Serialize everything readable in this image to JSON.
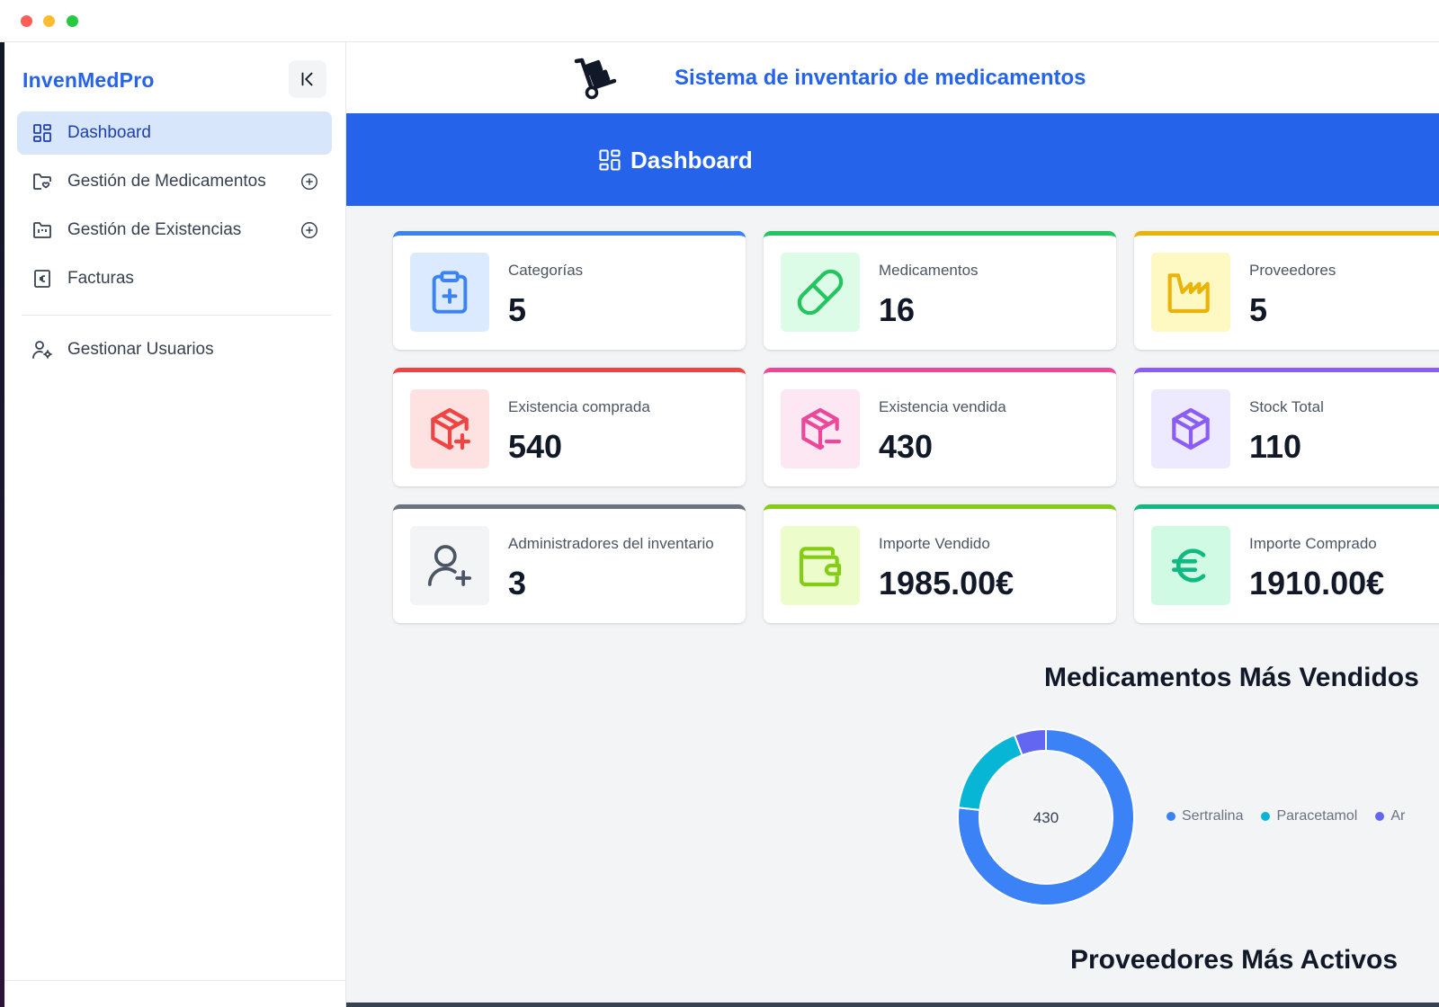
{
  "sidebar": {
    "brand": "InvenMedPro",
    "items": [
      {
        "label": "Dashboard",
        "active": true
      },
      {
        "label": "Gestión de Medicamentos",
        "expandable": true
      },
      {
        "label": "Gestión de Existencias",
        "expandable": true
      },
      {
        "label": "Facturas"
      },
      {
        "label": "Gestionar Usuarios"
      }
    ]
  },
  "header": {
    "title": "Sistema de inventario de medicamentos",
    "banner_title": "Dashboard"
  },
  "cards": [
    {
      "label": "Categorías",
      "value": "5",
      "accent": "#3b82f6",
      "icon": "clipboard-plus-icon"
    },
    {
      "label": "Medicamentos",
      "value": "16",
      "accent": "#22c55e",
      "icon": "pill-icon"
    },
    {
      "label": "Proveedores",
      "value": "5",
      "accent": "#eab308",
      "icon": "factory-icon"
    },
    {
      "label": "Existencia comprada",
      "value": "540",
      "accent": "#ef4444",
      "icon": "package-plus-icon"
    },
    {
      "label": "Existencia vendida",
      "value": "430",
      "accent": "#ec4899",
      "icon": "package-minus-icon"
    },
    {
      "label": "Stock Total",
      "value": "110",
      "accent": "#8b5cf6",
      "icon": "package-icon"
    },
    {
      "label": "Administradores del inventario",
      "value": "3",
      "accent": "#6b7280",
      "icon": "user-plus-icon"
    },
    {
      "label": "Importe Vendido",
      "value": "1985.00€",
      "accent": "#84cc16",
      "icon": "wallet-icon"
    },
    {
      "label": "Importe Comprado",
      "value": "1910.00€",
      "accent": "#10b981",
      "icon": "euro-icon"
    }
  ],
  "sections": {
    "top_sold_title": "Medicamentos Más Vendidos",
    "top_suppliers_title": "Proveedores Más Activos"
  },
  "chart_data": {
    "type": "pie",
    "center_label": "430",
    "categories": [
      "Sertralina",
      "Paracetamol",
      "Ar"
    ],
    "values": [
      330,
      75,
      25
    ],
    "colors": [
      "#3b82f6",
      "#06b6d4",
      "#6366f1"
    ]
  }
}
